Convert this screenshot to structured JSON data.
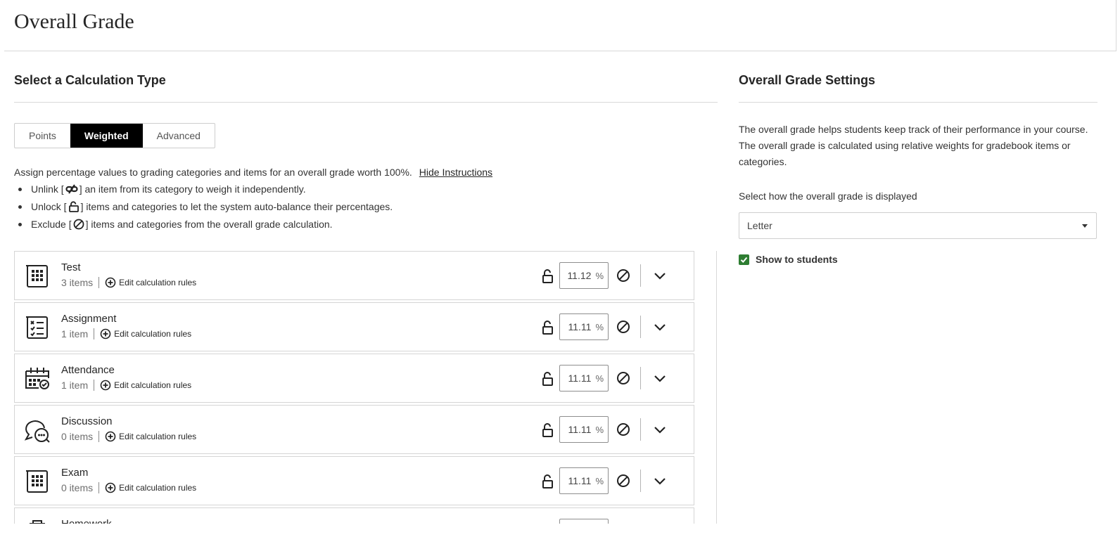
{
  "page": {
    "title": "Overall Grade"
  },
  "calc": {
    "heading": "Select a Calculation Type",
    "tabs": [
      {
        "label": "Points",
        "active": false
      },
      {
        "label": "Weighted",
        "active": true
      },
      {
        "label": "Advanced",
        "active": false
      }
    ],
    "instructions": {
      "lead": "Assign percentage values to grading categories and items for an overall grade worth 100%.",
      "hide_link": "Hide Instructions",
      "bullets": [
        {
          "before": "Unlink [",
          "icon": "unlink-icon",
          "after": "] an item from its category to weigh it independently."
        },
        {
          "before": "Unlock [",
          "icon": "unlock-icon",
          "after": "] items and categories to let the system auto-balance their percentages."
        },
        {
          "before": "Exclude [",
          "icon": "exclude-icon",
          "after": "] items and categories from the overall grade calculation."
        }
      ]
    },
    "edit_rules_label": "Edit calculation rules",
    "percent_unit": "%",
    "categories": [
      {
        "name": "Test",
        "count": "3 items",
        "percent": "11.12",
        "icon": "test-icon"
      },
      {
        "name": "Assignment",
        "count": "1 item",
        "percent": "11.11",
        "icon": "assignment-icon"
      },
      {
        "name": "Attendance",
        "count": "1 item",
        "percent": "11.11",
        "icon": "attendance-icon"
      },
      {
        "name": "Discussion",
        "count": "0 items",
        "percent": "11.11",
        "icon": "discussion-icon"
      },
      {
        "name": "Exam",
        "count": "0 items",
        "percent": "11.11",
        "icon": "exam-icon"
      },
      {
        "name": "Homework",
        "count": "",
        "percent": "",
        "icon": "homework-icon"
      }
    ]
  },
  "settings": {
    "heading": "Overall Grade Settings",
    "description": "The overall grade helps students keep track of their performance in your course. The overall grade is calculated using relative weights for gradebook items or categories.",
    "display_label": "Select how the overall grade is displayed",
    "display_value": "Letter",
    "show_to_students_label": "Show to students",
    "show_to_students_checked": true,
    "accent_color": "#2e7d32"
  }
}
